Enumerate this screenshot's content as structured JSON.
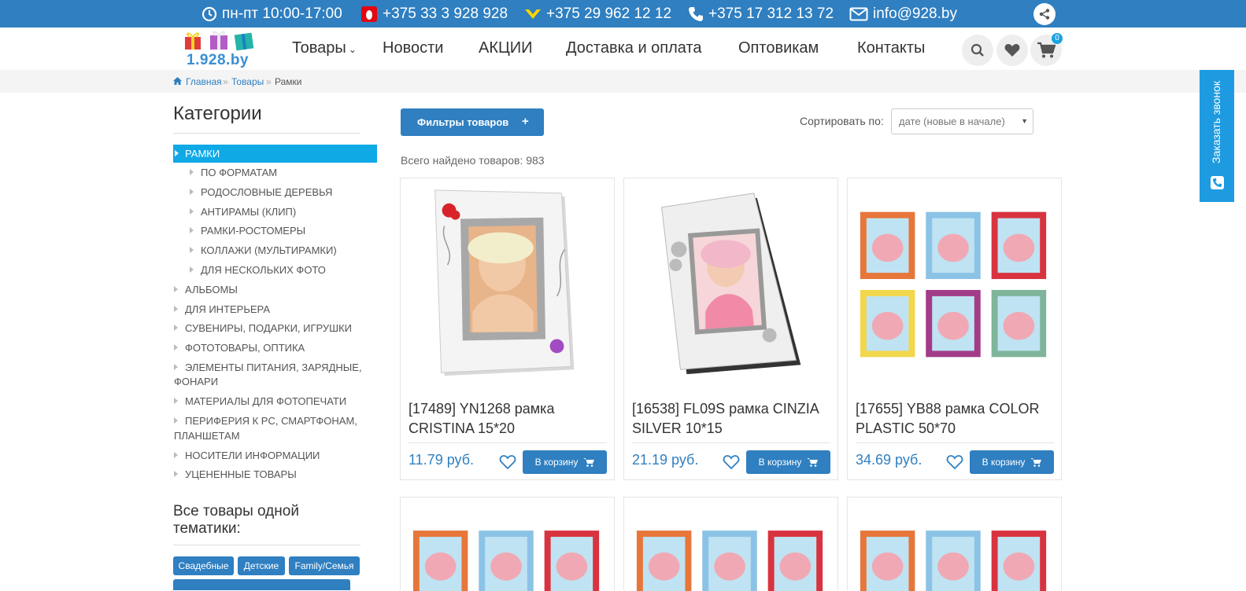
{
  "topbar": {
    "hours": "пн-пт 10:00-17:00",
    "phone_mts": "+375 33 3 928 928",
    "phone_velcom": "+375 29 962 12 12",
    "phone_city": "+375 17 312 13 72",
    "email": "info@928.by"
  },
  "logo": {
    "text": "1.928.by"
  },
  "nav": {
    "items": [
      "Товары",
      "Новости",
      "АКЦИИ",
      "Доставка и оплата",
      "Оптовикам",
      "Контакты"
    ]
  },
  "cart": {
    "count": "0"
  },
  "breadcrumb": {
    "home": "Главная",
    "goods": "Товары",
    "current": "Рамки"
  },
  "sidebar": {
    "title": "Категории",
    "active": "РАМКИ",
    "subitems": [
      "ПО ФОРМАТАМ",
      "РОДОСЛОВНЫЕ ДЕРЕВЬЯ",
      "АНТИРАМЫ (КЛИП)",
      "РАМКИ-РОСТОМЕРЫ",
      "КОЛЛАЖИ (МУЛЬТИРАМКИ)",
      "ДЛЯ НЕСКОЛЬКИХ ФОТО"
    ],
    "items": [
      "АЛЬБОМЫ",
      "ДЛЯ ИНТЕРЬЕРА",
      "СУВЕНИРЫ, ПОДАРКИ, ИГРУШКИ",
      "ФОТОТОВАРЫ, ОПТИКА",
      "ЭЛЕМЕНТЫ ПИТАНИЯ, ЗАРЯДНЫЕ,",
      "ФОНАРИ",
      "МАТЕРИАЛЫ ДЛЯ ФОТОПЕЧАТИ",
      "ПЕРИФЕРИЯ К PC, СМАРТФОНАМ,",
      "ПЛАНШЕТАМ",
      "НОСИТЕЛИ ИНФОРМАЦИИ",
      "УЦЕНЕННЫЕ ТОВАРЫ"
    ],
    "theme_title": "Все товары одной тематики:",
    "tags": [
      "Свадебные",
      "Детские",
      "Family/Семья"
    ]
  },
  "toolbar": {
    "filter_label": "Фильтры товаров",
    "sort_label": "Сортировать по:",
    "sort_value": "дате (новые в начале)",
    "found": "Всего найдено товаров: 983"
  },
  "products": [
    {
      "title": "[17489] YN1268 рамка CRISTINA 15*20",
      "price": "11.79 руб.",
      "cart_label": "В корзину"
    },
    {
      "title": "[16538] FL09S рамка CINZIA SILVER 10*15",
      "price": "21.19 руб.",
      "cart_label": "В корзину"
    },
    {
      "title": "[17655] YB88 рамка COLOR PLASTIC 50*70",
      "price": "34.69 руб.",
      "cart_label": "В корзину"
    }
  ],
  "callback": {
    "label": "Заказать звонок"
  }
}
